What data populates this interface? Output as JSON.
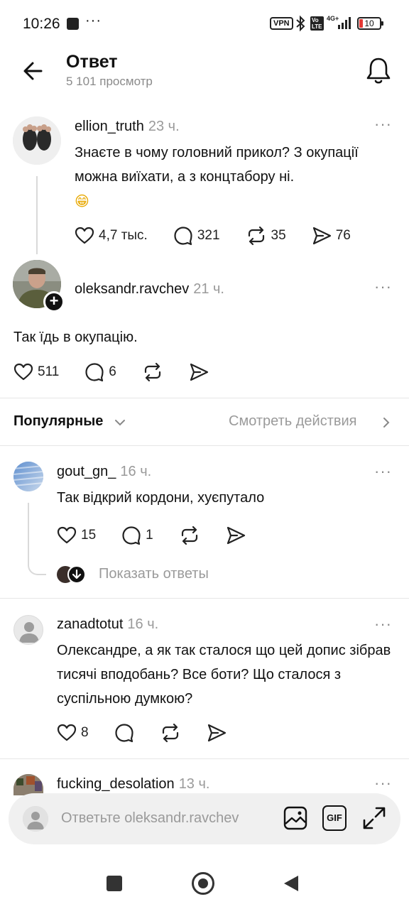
{
  "status_bar": {
    "time": "10:26",
    "dots": "···",
    "vpn": "VPN",
    "volte": "Vo LTE",
    "network": "4G+",
    "battery": "10"
  },
  "header": {
    "title": "Ответ",
    "views": "5 101 просмотр"
  },
  "original_post": {
    "username": "ellion_truth",
    "time": "23 ч.",
    "text": "Знаєте в чому головний прикол? З окупації можна виїхати, а з концтабору ні.",
    "emoji": "😁",
    "likes": "4,7 тыс.",
    "comments": "321",
    "reposts": "35",
    "shares": "76"
  },
  "reply_post": {
    "username": "oleksandr.ravchev",
    "time": "21 ч.",
    "text": "Так їдь в окупацію.",
    "likes": "511",
    "comments": "6"
  },
  "sort_bar": {
    "label": "Популярные",
    "view_activity": "Смотреть действия"
  },
  "comments": [
    {
      "username": "gout_gn_",
      "time": "16 ч.",
      "text": "Так відкрий кордони, хуєпутало",
      "likes": "15",
      "comments": "1",
      "show_replies": "Показать ответы"
    },
    {
      "username": "zanadtotut",
      "time": "16 ч.",
      "text": "Олександре, а як так сталося що цей допис зібрав тисячі вподобань? Все боти? Що сталося з суспільною думкою?",
      "likes": "8"
    },
    {
      "username": "fucking_desolation",
      "time": "13 ч."
    }
  ],
  "reply_bar": {
    "placeholder": "Ответьте oleksandr.ravchev",
    "gif_label": "GIF"
  },
  "icons": {
    "heart": "heart-icon",
    "comment": "comment-icon",
    "repost": "repost-icon",
    "share": "share-icon",
    "more": "more-icon",
    "bell": "bell-icon"
  },
  "colors": {
    "text": "#111111",
    "muted": "#9a9a9a",
    "divider": "#e6e6e6",
    "reply_bar_bg": "#f0f0f0",
    "battery_low": "#e53935"
  }
}
